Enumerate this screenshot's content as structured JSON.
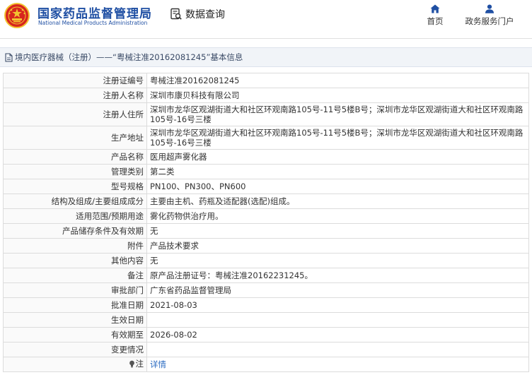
{
  "header": {
    "site_name_cn": "国家药品监督管理局",
    "site_name_en": "National Medical Products Administration",
    "nav_title": "数据查询",
    "nav_home": "首页",
    "nav_services": "政务服务门户"
  },
  "breadcrumb": {
    "text": "境内医疗器械（注册）——“粤械注准20162081245”基本信息"
  },
  "rows": [
    {
      "label": "注册证编号",
      "value": "粤械注准20162081245"
    },
    {
      "label": "注册人名称",
      "value": "深圳市康贝科技有限公司"
    },
    {
      "label": "注册人住所",
      "value": "深圳市龙华区观湖街道大和社区环观南路105号-11号5楼B号；深圳市龙华区观湖街道大和社区环观南路105号-16号三楼"
    },
    {
      "label": "生产地址",
      "value": "深圳市龙华区观湖街道大和社区环观南路105号-11号5楼B号；深圳市龙华区观湖街道大和社区环观南路105号-16号三楼"
    },
    {
      "label": "产品名称",
      "value": "医用超声雾化器"
    },
    {
      "label": "管理类别",
      "value": "第二类"
    },
    {
      "label": "型号规格",
      "value": "PN100、PN300、PN600"
    },
    {
      "label": "结构及组成/主要组成成分",
      "value": "主要由主机、药瓶及适配器(选配)组成。"
    },
    {
      "label": "适用范围/预期用途",
      "value": "雾化药物供治疗用。"
    },
    {
      "label": "产品储存条件及有效期",
      "value": "无"
    },
    {
      "label": "附件",
      "value": "产品技术要求"
    },
    {
      "label": "其他内容",
      "value": "无"
    },
    {
      "label": "备注",
      "value": "原产品注册证号：粤械注准20162231245。"
    },
    {
      "label": "审批部门",
      "value": "广东省药品监督管理局"
    },
    {
      "label": "批准日期",
      "value": "2021-08-03"
    },
    {
      "label": "生效日期",
      "value": ""
    },
    {
      "label": "有效期至",
      "value": "2026-08-02"
    },
    {
      "label": "变更情况",
      "value": ""
    },
    {
      "label": "注",
      "value": "详情"
    }
  ],
  "colors": {
    "brand_blue": "#1f4fa3",
    "emblem_red": "#d7261e",
    "emblem_gold": "#f2c230",
    "link_blue": "#2b6bc1"
  },
  "icons": {
    "emblem": "national-emblem-icon",
    "nav_title": "search-document-icon",
    "home": "home-icon",
    "services": "user-icon",
    "breadcrumb": "document-icon",
    "note": "lightbulb-icon"
  }
}
